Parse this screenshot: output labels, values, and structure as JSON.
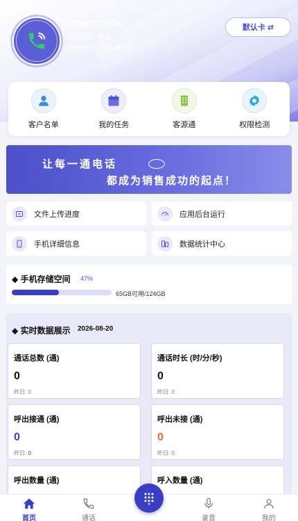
{
  "profile": {
    "phone": "18989771976",
    "status_line": "通讯状态：在线",
    "expiry_line": "到期时间：2026-08-25",
    "card_button": "默认卡 ⇄"
  },
  "quick_actions": [
    {
      "label": "客户名单",
      "icon": "user-icon"
    },
    {
      "label": "我的任务",
      "icon": "calendar-icon"
    },
    {
      "label": "客源通",
      "icon": "building-icon"
    },
    {
      "label": "权限检测",
      "icon": "gear-icon"
    }
  ],
  "banner": {
    "line1": "让每一通电话",
    "line2": "都成为销售成功的起点！"
  },
  "tiles": [
    {
      "label": "文件上传进度",
      "icon": "upload-icon"
    },
    {
      "label": "应用后台运行",
      "icon": "gauge-icon"
    },
    {
      "label": "手机详细信息",
      "icon": "mobile-icon"
    },
    {
      "label": "数据统计中心",
      "icon": "chart-icon"
    }
  ],
  "storage": {
    "title": "◆ 手机存储空间",
    "percent_label": "47%",
    "used_fraction": 0.47,
    "capacity_text": "65GB可用/124GB"
  },
  "realtime": {
    "title": "◆ 实时数据展示",
    "date": "2026-08-20",
    "stats": [
      {
        "label": "通话总数 (通)",
        "value": "0",
        "yesterday_label": "昨日: ",
        "yesterday_value": "0",
        "value_color": "#111111"
      },
      {
        "label": "通话时长 (时/分/秒)",
        "value": "0",
        "yesterday_label": "昨日: ",
        "yesterday_value": "0",
        "value_color": "#111111"
      },
      {
        "label": "呼出接通 (通)",
        "value": "0",
        "yesterday_label": "昨日: ",
        "yesterday_value": "0",
        "value_color": "#3a3ec2"
      },
      {
        "label": "呼出未接 (通)",
        "value": "0",
        "yesterday_label": "昨日: ",
        "yesterday_value": "0",
        "value_color": "#e8692c"
      },
      {
        "label": "呼出数量 (通)",
        "value": "",
        "yesterday_label": "",
        "yesterday_value": "",
        "value_color": "#111111"
      },
      {
        "label": "呼入数量 (通)",
        "value": "",
        "yesterday_label": "",
        "yesterday_value": "",
        "value_color": "#111111"
      }
    ]
  },
  "tabbar": {
    "tabs": [
      {
        "label": "首页",
        "icon": "home-icon",
        "active": true
      },
      {
        "label": "通话",
        "icon": "phone-icon",
        "active": false
      },
      {
        "label": "录音",
        "icon": "microphone-icon",
        "active": false
      },
      {
        "label": "我的",
        "icon": "person-icon",
        "active": false
      }
    ],
    "dial_icon": "dialpad-icon"
  },
  "colors": {
    "accent": "#3a3ec2",
    "warning": "#e8692c"
  }
}
